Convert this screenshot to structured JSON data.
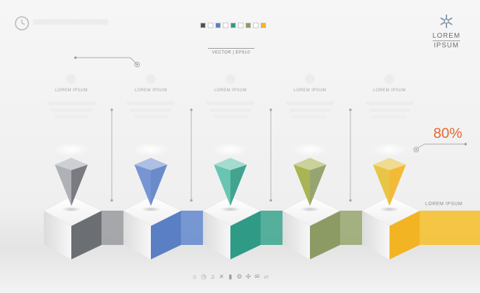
{
  "header": {
    "vector_label": "VECTOR | EPS10",
    "logo_line1": "LOREM",
    "logo_line2": "IPSUM"
  },
  "swatches": [
    "#4d5158",
    "#ffffff",
    "#5b7fc4",
    "#ffffff",
    "#2f9a86",
    "#ffffff",
    "#8c9b64",
    "#ffffff",
    "#f2b423"
  ],
  "percent_label": "80%",
  "ribbon_label": "LOREM IPSUM",
  "steps": [
    {
      "label": "LOREM IPSUM",
      "color": "#6b6e73",
      "cone": "#aaadb3",
      "strip": "#9fa1a5"
    },
    {
      "label": "LOREM IPSUM",
      "color": "#5b7fc4",
      "cone": "#6f8fd0",
      "strip": "#6c8fd0"
    },
    {
      "label": "LOREM IPSUM",
      "color": "#2f9a86",
      "cone": "#61c2ab",
      "strip": "#46a994"
    },
    {
      "label": "LOREM IPSUM",
      "color": "#8c9b64",
      "cone": "#a4b04a",
      "strip": "#9cab77"
    },
    {
      "label": "LOREM IPSUM",
      "color": "#f2b423",
      "cone": "#e8c23d",
      "strip": "#f5c236"
    }
  ],
  "icons": {
    "clock": "clock-icon",
    "logo": "snowflake-logo-icon",
    "bottom": [
      "home-icon",
      "clock-icon",
      "bell-icon",
      "tools-icon",
      "bar-chart-icon",
      "gear-icon",
      "puzzle-icon",
      "mail-icon",
      "folder-icon"
    ]
  }
}
